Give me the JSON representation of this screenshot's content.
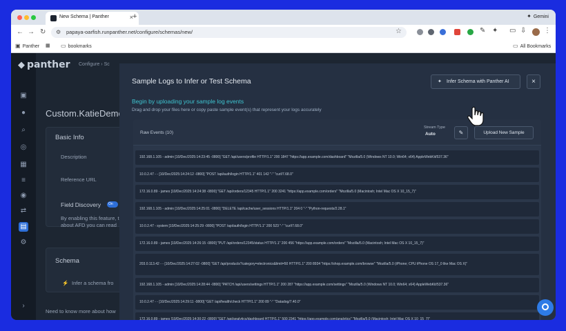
{
  "browser": {
    "tab_title": "New Schema | Panther",
    "tab_close": "×",
    "new_tab": "+",
    "gemini_label": "Gemini",
    "gemini_icon": "✦",
    "url": "papaya-oarfish.runpanther.net/configure/schemas/new/",
    "star_icon": "☆",
    "nav": {
      "back": "←",
      "forward": "→",
      "reload": "↻"
    },
    "bookmarks": {
      "panther": "Panther",
      "folder": "bookmarks",
      "all": "All Bookmarks"
    }
  },
  "app": {
    "logo": "panther",
    "breadcrumb": "Configure  ›  Sc",
    "schema_name": "Custom.KatieDeme",
    "basic_info": "Basic Info",
    "description_label": "Description",
    "reference_url_label": "Reference URL",
    "field_discovery": "Field Discovery",
    "toggle_label": "On",
    "field_discovery_desc_1": "By enabling this feature, th",
    "field_discovery_desc_2": "about AFD you can read",
    "schema_heading": "Schema",
    "infer_schema_text": "Infer a schema fro",
    "need_more": "Need to know more about how"
  },
  "modal": {
    "title": "Sample Logs to Infer or Test Schema",
    "infer_button": "Infer Schema with Panther AI",
    "close": "×",
    "subtitle": "Begin by uploading your sample log events",
    "description": "Drag and drop your files here or copy paste sample event(s) that represent your logs accurately",
    "raw_events_label": "Raw Events (10)",
    "stream_type_label": "Stream Type",
    "stream_type_value": "Auto",
    "upload_button": "Upload New Sample",
    "events": [
      "192.168.1.105 - admin [10/Dec/2025:14:23:45 -0800] \"GET /api/users/profile HTTP/1.1\" 200 1847 \"https://app.example.com/dashboard\" \"Mozilla/5.0 (Windows NT 10.0; Win64; x64) AppleWebKit/537.36\"",
      "10.0.2.47 - - [10/Dec/2025:14:24:12 -0800] \"POST /api/auth/login HTTP/1.1\" 401 142 \"-\" \"curl/7.68.0\"",
      "172.16.0.89 - james [10/Dec/2025:14:24:38 -0800] \"GET /api/orders/12345 HTTP/1.1\" 200 3241 \"https://app.example.com/orders\" \"Mozilla/5.0 (Macintosh; Intel Mac OS X 10_15_7)\"",
      "192.168.1.105 - admin [10/Dec/2025:14:25:01 -0800] \"DELETE /api/cache/user_sessions HTTP/1.1\" 204 0 \"-\" \"Python-requests/2.28.1\"",
      "10.0.2.47 - system [10/Dec/2025:14:25:29 -0800] \"POST /api/auth/login HTTP/1.1\" 200 523 \"-\" \"curl/7.68.0\"",
      "172.16.0.89 - james [10/Dec/2025:14:26:15 -0800] \"PUT /api/orders/12345/status HTTP/1.1\" 200 456 \"https://app.example.com/orders\" \"Mozilla/5.0 (Macintosh; Intel Mac OS X 10_15_7)\"",
      "203.0.113.42 - - [10/Dec/2025:14:27:02 -0800] \"GET /api/products?category=electronics&limit=50 HTTP/1.1\" 200 8934 \"https://shop.example.com/browse\" \"Mozilla/5.0 (iPhone; CPU iPhone OS 17_0 like Mac OS X)\"",
      "192.168.1.105 - admin [10/Dec/2025:14:28:44 -0800] \"PATCH /api/users/settings HTTP/1.1\" 200 287 \"https://app.example.com/settings\" \"Mozilla/5.0 (Windows NT 10.0; Win64; x64) AppleWebKit/537.36\"",
      "10.0.2.47 - - [10/Dec/2025:14:29:11 -0800] \"GET /api/health/check HTTP/1.1\" 200 89 \"-\" \"Datadog/7.40.0\"",
      "172.16.0.89 - james [10/Dec/2025:14:30:22 -0800] \"GET /api/analytics/dashboard HTTP/1.1\" 500 2341 \"https://app.example.com/analytics\" \"Mozilla/5.0 (Macintosh; Intel Mac OS X 10_15_7)\""
    ]
  }
}
